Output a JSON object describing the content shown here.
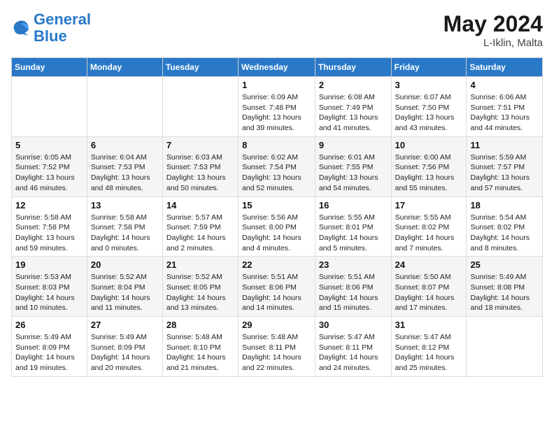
{
  "header": {
    "logo_general": "General",
    "logo_blue": "Blue",
    "month_year": "May 2024",
    "location": "L-Iklin, Malta"
  },
  "weekdays": [
    "Sunday",
    "Monday",
    "Tuesday",
    "Wednesday",
    "Thursday",
    "Friday",
    "Saturday"
  ],
  "weeks": [
    [
      {
        "day": "",
        "sunrise": "",
        "sunset": "",
        "daylight": ""
      },
      {
        "day": "",
        "sunrise": "",
        "sunset": "",
        "daylight": ""
      },
      {
        "day": "",
        "sunrise": "",
        "sunset": "",
        "daylight": ""
      },
      {
        "day": "1",
        "sunrise": "Sunrise: 6:09 AM",
        "sunset": "Sunset: 7:48 PM",
        "daylight": "Daylight: 13 hours and 39 minutes."
      },
      {
        "day": "2",
        "sunrise": "Sunrise: 6:08 AM",
        "sunset": "Sunset: 7:49 PM",
        "daylight": "Daylight: 13 hours and 41 minutes."
      },
      {
        "day": "3",
        "sunrise": "Sunrise: 6:07 AM",
        "sunset": "Sunset: 7:50 PM",
        "daylight": "Daylight: 13 hours and 43 minutes."
      },
      {
        "day": "4",
        "sunrise": "Sunrise: 6:06 AM",
        "sunset": "Sunset: 7:51 PM",
        "daylight": "Daylight: 13 hours and 44 minutes."
      }
    ],
    [
      {
        "day": "5",
        "sunrise": "Sunrise: 6:05 AM",
        "sunset": "Sunset: 7:52 PM",
        "daylight": "Daylight: 13 hours and 46 minutes."
      },
      {
        "day": "6",
        "sunrise": "Sunrise: 6:04 AM",
        "sunset": "Sunset: 7:53 PM",
        "daylight": "Daylight: 13 hours and 48 minutes."
      },
      {
        "day": "7",
        "sunrise": "Sunrise: 6:03 AM",
        "sunset": "Sunset: 7:53 PM",
        "daylight": "Daylight: 13 hours and 50 minutes."
      },
      {
        "day": "8",
        "sunrise": "Sunrise: 6:02 AM",
        "sunset": "Sunset: 7:54 PM",
        "daylight": "Daylight: 13 hours and 52 minutes."
      },
      {
        "day": "9",
        "sunrise": "Sunrise: 6:01 AM",
        "sunset": "Sunset: 7:55 PM",
        "daylight": "Daylight: 13 hours and 54 minutes."
      },
      {
        "day": "10",
        "sunrise": "Sunrise: 6:00 AM",
        "sunset": "Sunset: 7:56 PM",
        "daylight": "Daylight: 13 hours and 55 minutes."
      },
      {
        "day": "11",
        "sunrise": "Sunrise: 5:59 AM",
        "sunset": "Sunset: 7:57 PM",
        "daylight": "Daylight: 13 hours and 57 minutes."
      }
    ],
    [
      {
        "day": "12",
        "sunrise": "Sunrise: 5:58 AM",
        "sunset": "Sunset: 7:58 PM",
        "daylight": "Daylight: 13 hours and 59 minutes."
      },
      {
        "day": "13",
        "sunrise": "Sunrise: 5:58 AM",
        "sunset": "Sunset: 7:58 PM",
        "daylight": "Daylight: 14 hours and 0 minutes."
      },
      {
        "day": "14",
        "sunrise": "Sunrise: 5:57 AM",
        "sunset": "Sunset: 7:59 PM",
        "daylight": "Daylight: 14 hours and 2 minutes."
      },
      {
        "day": "15",
        "sunrise": "Sunrise: 5:56 AM",
        "sunset": "Sunset: 8:00 PM",
        "daylight": "Daylight: 14 hours and 4 minutes."
      },
      {
        "day": "16",
        "sunrise": "Sunrise: 5:55 AM",
        "sunset": "Sunset: 8:01 PM",
        "daylight": "Daylight: 14 hours and 5 minutes."
      },
      {
        "day": "17",
        "sunrise": "Sunrise: 5:55 AM",
        "sunset": "Sunset: 8:02 PM",
        "daylight": "Daylight: 14 hours and 7 minutes."
      },
      {
        "day": "18",
        "sunrise": "Sunrise: 5:54 AM",
        "sunset": "Sunset: 8:02 PM",
        "daylight": "Daylight: 14 hours and 8 minutes."
      }
    ],
    [
      {
        "day": "19",
        "sunrise": "Sunrise: 5:53 AM",
        "sunset": "Sunset: 8:03 PM",
        "daylight": "Daylight: 14 hours and 10 minutes."
      },
      {
        "day": "20",
        "sunrise": "Sunrise: 5:52 AM",
        "sunset": "Sunset: 8:04 PM",
        "daylight": "Daylight: 14 hours and 11 minutes."
      },
      {
        "day": "21",
        "sunrise": "Sunrise: 5:52 AM",
        "sunset": "Sunset: 8:05 PM",
        "daylight": "Daylight: 14 hours and 13 minutes."
      },
      {
        "day": "22",
        "sunrise": "Sunrise: 5:51 AM",
        "sunset": "Sunset: 8:06 PM",
        "daylight": "Daylight: 14 hours and 14 minutes."
      },
      {
        "day": "23",
        "sunrise": "Sunrise: 5:51 AM",
        "sunset": "Sunset: 8:06 PM",
        "daylight": "Daylight: 14 hours and 15 minutes."
      },
      {
        "day": "24",
        "sunrise": "Sunrise: 5:50 AM",
        "sunset": "Sunset: 8:07 PM",
        "daylight": "Daylight: 14 hours and 17 minutes."
      },
      {
        "day": "25",
        "sunrise": "Sunrise: 5:49 AM",
        "sunset": "Sunset: 8:08 PM",
        "daylight": "Daylight: 14 hours and 18 minutes."
      }
    ],
    [
      {
        "day": "26",
        "sunrise": "Sunrise: 5:49 AM",
        "sunset": "Sunset: 8:09 PM",
        "daylight": "Daylight: 14 hours and 19 minutes."
      },
      {
        "day": "27",
        "sunrise": "Sunrise: 5:49 AM",
        "sunset": "Sunset: 8:09 PM",
        "daylight": "Daylight: 14 hours and 20 minutes."
      },
      {
        "day": "28",
        "sunrise": "Sunrise: 5:48 AM",
        "sunset": "Sunset: 8:10 PM",
        "daylight": "Daylight: 14 hours and 21 minutes."
      },
      {
        "day": "29",
        "sunrise": "Sunrise: 5:48 AM",
        "sunset": "Sunset: 8:11 PM",
        "daylight": "Daylight: 14 hours and 22 minutes."
      },
      {
        "day": "30",
        "sunrise": "Sunrise: 5:47 AM",
        "sunset": "Sunset: 8:11 PM",
        "daylight": "Daylight: 14 hours and 24 minutes."
      },
      {
        "day": "31",
        "sunrise": "Sunrise: 5:47 AM",
        "sunset": "Sunset: 8:12 PM",
        "daylight": "Daylight: 14 hours and 25 minutes."
      },
      {
        "day": "",
        "sunrise": "",
        "sunset": "",
        "daylight": ""
      }
    ]
  ]
}
